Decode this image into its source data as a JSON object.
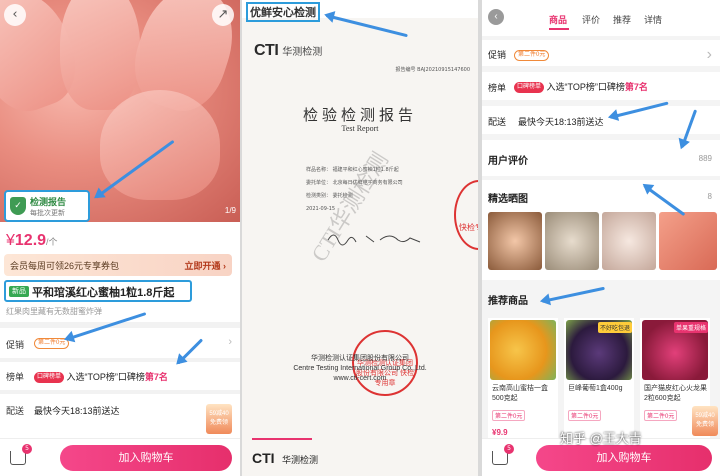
{
  "panel1": {
    "image_pager": "1/9",
    "report_badge": {
      "title": "检测报告",
      "subtitle": "每批次更新"
    },
    "price": {
      "currency": "¥",
      "value": "12.9",
      "unit": "/个"
    },
    "member": {
      "text": "会员每周可领26元专享券包",
      "action": "立即开通 ›"
    },
    "product": {
      "tag": "新品",
      "title": "平和琯溪红心蜜柚1粒1.8斤起"
    },
    "subnote": "红果肉里藏有无数甜蜜炸弹",
    "rows": {
      "promo": {
        "label": "促销",
        "pill": "第二件0元"
      },
      "rank": {
        "label": "榜单",
        "pill": "口碑榜单",
        "text_prefix": "入选“TOP榜”口碑榜",
        "rank": "第7名"
      },
      "delivery": {
        "label": "配送",
        "text": "最快今天18:13前送达"
      }
    },
    "float_card": "59减40 免费领",
    "cart_count": "5",
    "add_cart": "加入购物车"
  },
  "panel2": {
    "header": "优鲜安心检测",
    "logo_en": "CTI",
    "logo_cn": "华测检测",
    "report_no": "报告编号 BAJ20210915147600",
    "title": "检验检测报告",
    "subtitle": "Test Report",
    "fields": [
      "样品名称： 福建平和红心蜜柚1粒1.8斤起",
      "委托单位： 北京每日优鲜电子商务有限公司",
      "检测类别： 委托检测",
      "",
      "",
      "2021-09-15"
    ],
    "stamp_side": "快检专用章",
    "stamp_main": "华测检测认证集团股份有限公司 快检专用章",
    "watermark": "CTI华测检测",
    "footer_cn": "华测检测认证集团股份有限公司",
    "footer_en": "Centre Testing International Group Co.,Ltd.",
    "footer_url": "www.cti-cert.com",
    "bottom_logo_en": "CTI",
    "bottom_logo_cn": "华测检测"
  },
  "panel3": {
    "tabs": [
      "商品",
      "评价",
      "推荐",
      "详情"
    ],
    "active_tab": "商品",
    "promo": {
      "label": "促销",
      "pill": "第二件0元"
    },
    "rank": {
      "label": "榜单",
      "pill": "口碑榜单",
      "text_prefix": "入选“TOP榜”口碑榜",
      "rank": "第7名"
    },
    "delivery": {
      "label": "配送",
      "text": "最快今天18:13前送达"
    },
    "reviews": {
      "title": "用户评价",
      "count": "889"
    },
    "photos": {
      "title": "精选晒图",
      "count": "8"
    },
    "recommend": {
      "title": "推荐商品"
    },
    "products": [
      {
        "name": "云南高山蜜桔一盒500克起",
        "limit": "第二件0元",
        "price": "¥9.9",
        "corner": ""
      },
      {
        "name": "巨峰葡萄1盒400g",
        "limit": "第二件0元",
        "price": "",
        "corner": "不好吃包退"
      },
      {
        "name": "国产猫皮红心火龙果2粒600克起",
        "limit": "第二件0元",
        "price": "",
        "corner": "单果重规格"
      }
    ],
    "float_card": "59减40 免费领",
    "cart_count": "5",
    "add_cart": "加入购物车",
    "watermark": "知乎 @王大青"
  },
  "colors": {
    "accent": "#e8336f",
    "annotation": "#3d8fe0",
    "report_green": "#3f9b54"
  }
}
